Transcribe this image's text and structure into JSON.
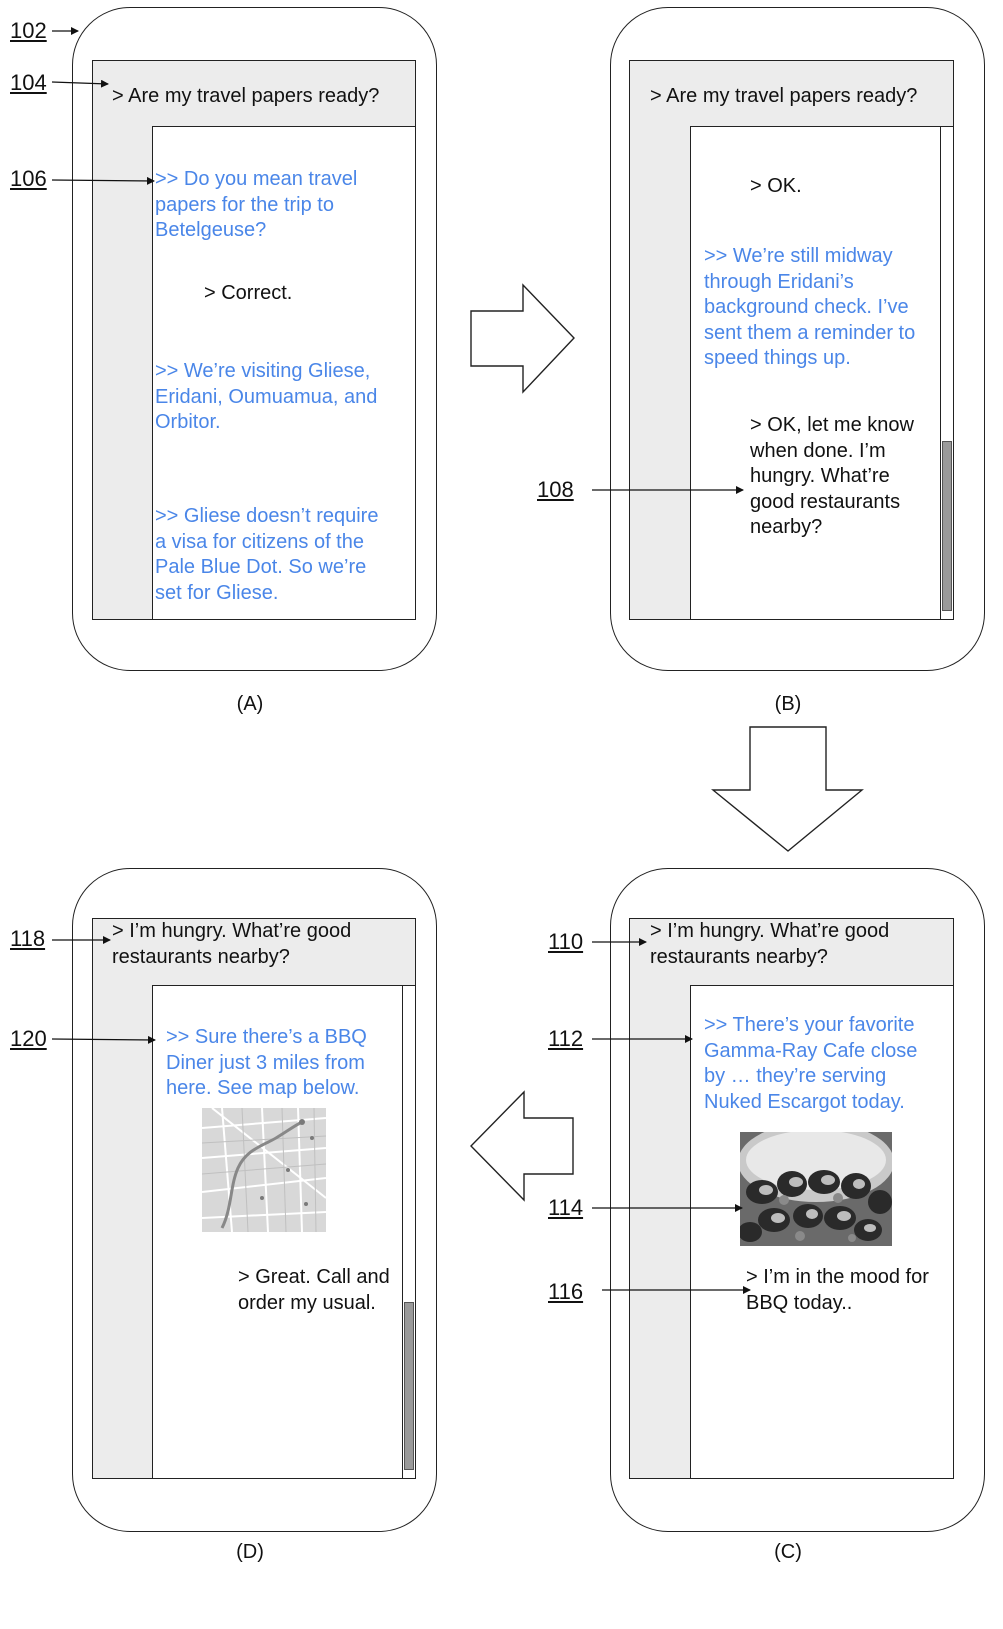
{
  "panels": {
    "a": {
      "caption": "(A)",
      "header": "> Are my travel papers ready?",
      "messages": {
        "m1": ">> Do you mean travel\npapers for the trip to\nBetelgeuse?",
        "m2": "> Correct.",
        "m3": ">> We’re visiting Gliese,\nEridani, Oumuamua, and\nOrbitor.",
        "m4": ">> Gliese doesn’t require\na visa for citizens of the\nPale Blue Dot. So we’re\nset for Gliese."
      }
    },
    "b": {
      "caption": "(B)",
      "header": "> Are my travel papers ready?",
      "messages": {
        "m1": "> OK.",
        "m2": ">> We’re still midway\nthrough Eridani’s\nbackground check. I’ve\nsent them a reminder to\nspeed things up.",
        "m3": "> OK, let me know\nwhen done. I’m\nhungry. What’re\ngood restaurants\nnearby?"
      },
      "scroll_position": 0.75
    },
    "c": {
      "caption": "(C)",
      "header": "> I’m  hungry. What’re good\nrestaurants nearby?",
      "messages": {
        "m1": ">> There’s your favorite\nGamma-Ray Cafe close\nby … they’re serving\nNuked Escargot today.",
        "m2": "> I’m in the mood for\nBBQ today.."
      },
      "image": "escargot-photo"
    },
    "d": {
      "caption": "(D)",
      "header": "> I’m  hungry. What’re good\nrestaurants nearby?",
      "messages": {
        "m1": ">> Sure there’s a BBQ\nDiner just 3 miles from\nhere. See map below.",
        "m2": "> Great. Call and\norder my usual."
      },
      "image": "map-thumbnail",
      "scroll_position": 0.65
    }
  },
  "refs": {
    "r102": "102",
    "r104": "104",
    "r106": "106",
    "r108": "108",
    "r110": "110",
    "r112": "112",
    "r114": "114",
    "r116": "116",
    "r118": "118",
    "r120": "120"
  },
  "colors": {
    "assistant_text": "#4a86e8",
    "user_text": "#111111",
    "screen_background": "#ececec"
  }
}
